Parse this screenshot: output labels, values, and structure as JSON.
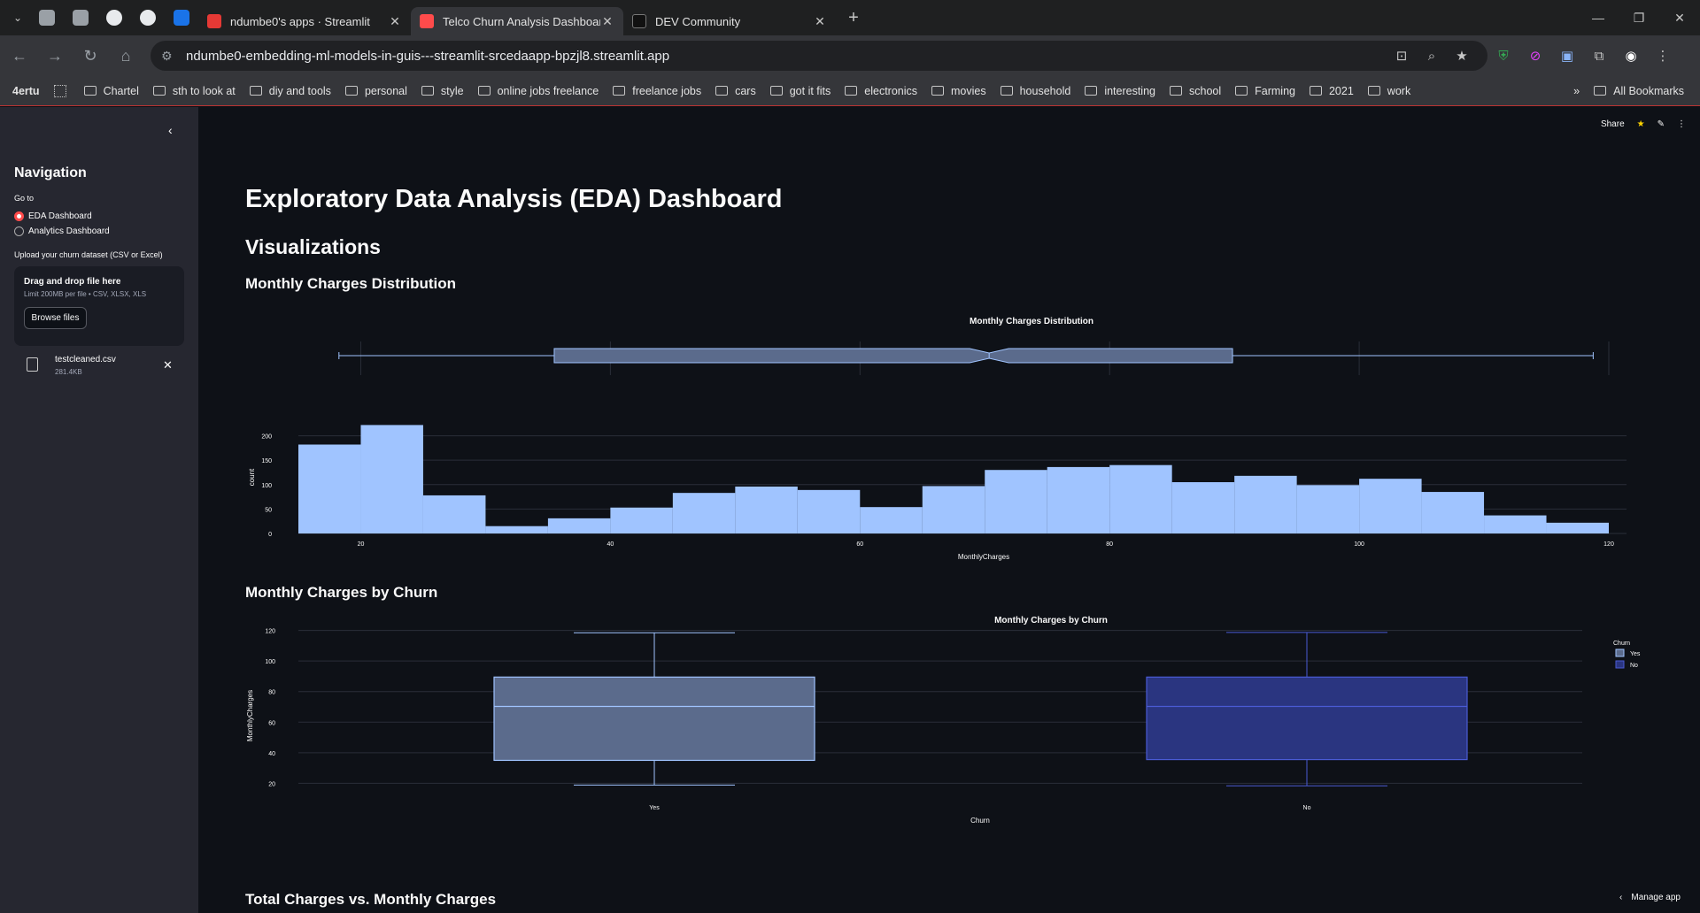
{
  "browser": {
    "tabs": [
      {
        "label": "ndumbe0's apps · Streamlit",
        "active": false,
        "color": "#e53935"
      },
      {
        "label": "Telco Churn Analysis Dashboard",
        "active": true,
        "color": "#ff4b4b"
      },
      {
        "label": "DEV Community",
        "active": false,
        "color": "#000000"
      }
    ],
    "url": "ndumbe0-embedding-ml-models-in-guis---streamlit-srcedaapp-bpzjl8.streamlit.app",
    "bookmarks_first": "4ertu",
    "bookmarks": [
      "Chartel",
      "sth to look at",
      "diy and tools",
      "personal",
      "style",
      "online jobs freelance",
      "freelance jobs",
      "cars",
      "got it fits",
      "electronics",
      "movies",
      "household",
      "interesting",
      "school",
      "Farming",
      "2021",
      "work"
    ],
    "all_bookmarks": "All Bookmarks"
  },
  "sidebar": {
    "title": "Navigation",
    "goto_label": "Go to",
    "options": [
      "EDA Dashboard",
      "Analytics Dashboard"
    ],
    "selected": "EDA Dashboard",
    "upload_label": "Upload your churn dataset (CSV or Excel)",
    "dropzone_title": "Drag and drop file here",
    "dropzone_sub": "Limit 200MB per file • CSV, XLSX, XLS",
    "browse_label": "Browse files",
    "file_name": "testcleaned.csv",
    "file_size": "281.4KB"
  },
  "toolbar": {
    "share": "Share"
  },
  "page": {
    "title": "Exploratory Data Analysis (EDA) Dashboard",
    "section": "Visualizations",
    "sub1": "Monthly Charges Distribution",
    "sub2": "Monthly Charges by Churn",
    "sub3": "Total Charges vs. Monthly Charges"
  },
  "manage_app": "Manage app",
  "colors": {
    "accent": "#ff4b4b",
    "hist": "#a0c4ff",
    "yes_box": "#5b6b8c",
    "no_box": "#2a3580"
  },
  "chart_data": [
    {
      "type": "bar",
      "title": "Monthly Charges Distribution",
      "xlabel": "MonthlyCharges",
      "ylabel": "count",
      "bin_edges": [
        15,
        20,
        25,
        30,
        35,
        40,
        45,
        50,
        55,
        60,
        65,
        70,
        75,
        80,
        85,
        90,
        95,
        100,
        105,
        110,
        115,
        120
      ],
      "values": [
        182,
        222,
        78,
        15,
        31,
        53,
        83,
        96,
        89,
        54,
        97,
        130,
        136,
        140,
        105,
        118,
        99,
        112,
        85,
        37,
        22
      ],
      "xlim": [
        15,
        120
      ],
      "ylim": [
        0,
        230
      ],
      "xticks": [
        20,
        40,
        60,
        80,
        100,
        120
      ],
      "yticks": [
        0,
        50,
        100,
        150,
        200
      ],
      "marginal_box": {
        "min": 18.25,
        "q1": 35.5,
        "median": 70.35,
        "q3": 89.85,
        "max": 118.75
      }
    },
    {
      "type": "box",
      "title": "Monthly Charges by Churn",
      "xlabel": "Churn",
      "ylabel": "MonthlyCharges",
      "categories": [
        "Yes",
        "No"
      ],
      "series": [
        {
          "name": "Yes",
          "min": 18.8,
          "q1": 35.0,
          "median": 70.3,
          "q3": 89.5,
          "max": 118.5
        },
        {
          "name": "No",
          "min": 18.3,
          "q1": 35.5,
          "median": 70.3,
          "q3": 89.5,
          "max": 118.7
        }
      ],
      "ylim": [
        15,
        125
      ],
      "yticks": [
        20,
        40,
        60,
        80,
        100,
        120
      ],
      "legend_title": "Churn",
      "legend": [
        "Yes",
        "No"
      ]
    }
  ]
}
